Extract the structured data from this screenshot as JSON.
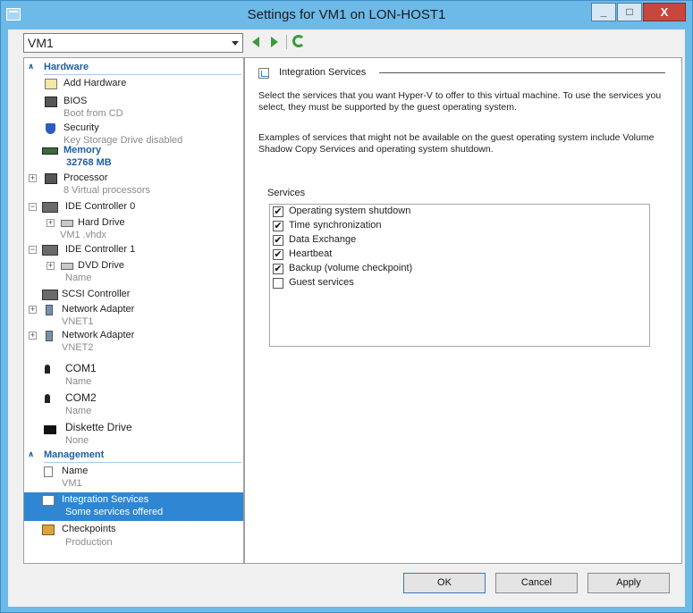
{
  "window": {
    "title": "Settings for VM1  on LON-HOST1"
  },
  "vm_selector": {
    "value": "VM1"
  },
  "tree": {
    "hardware_section": "Hardware",
    "management_section": "Management",
    "items": {
      "add_hardware": {
        "name": "Add Hardware"
      },
      "bios": {
        "name": "BIOS",
        "sub": "Boot from CD"
      },
      "security": {
        "name": "Security",
        "sub": "Key Storage Drive disabled"
      },
      "memory": {
        "name": "Memory",
        "sub": "32768 MB"
      },
      "processor": {
        "name": "Processor",
        "sub": "8 Virtual processors"
      },
      "ide0": {
        "name": "IDE Controller  0"
      },
      "hard_drive": {
        "name": "Hard Drive",
        "sub": "VM1 .vhdx"
      },
      "ide1": {
        "name": "IDE Controller  1"
      },
      "dvd_drive": {
        "name": "DVD Drive",
        "sub": "Name"
      },
      "scsi": {
        "name": "SCSI Controller"
      },
      "nic1": {
        "name": "Network Adapter",
        "sub": "VNET1"
      },
      "nic2": {
        "name": "Network Adapter",
        "sub": "VNET2"
      },
      "com1": {
        "name": "COM1",
        "sub": "Name"
      },
      "com2": {
        "name": "COM2",
        "sub": "Name"
      },
      "diskette": {
        "name": "Diskette Drive",
        "sub": "None"
      },
      "mgmt_name": {
        "name": "Name",
        "sub": "VM1"
      },
      "integration": {
        "name": "Integration Services",
        "sub": "Some services offered"
      },
      "checkpoints": {
        "name": "Checkpoints",
        "sub": "Production"
      }
    }
  },
  "panel": {
    "title": "Integration Services",
    "description": "Select the services that you want Hyper-V to offer to this virtual machine. To use the services you select, they must be supported by the guest operating system.",
    "examples": "Examples of services that might not be available on the guest operating system include Volume Shadow Copy Services and operating system shutdown.",
    "services_label": "Services",
    "services": [
      {
        "label": "Operating system shutdown",
        "checked": true
      },
      {
        "label": "Time synchronization",
        "checked": true
      },
      {
        "label": "Data Exchange",
        "checked": true
      },
      {
        "label": "Heartbeat",
        "checked": true
      },
      {
        "label": "Backup (volume checkpoint)",
        "checked": true
      },
      {
        "label": "Guest services",
        "checked": false
      }
    ]
  },
  "buttons": {
    "ok": "OK",
    "cancel": "Cancel",
    "apply": "Apply"
  },
  "title_buttons": {
    "minimize": "_",
    "maximize": "□",
    "close": "X"
  }
}
